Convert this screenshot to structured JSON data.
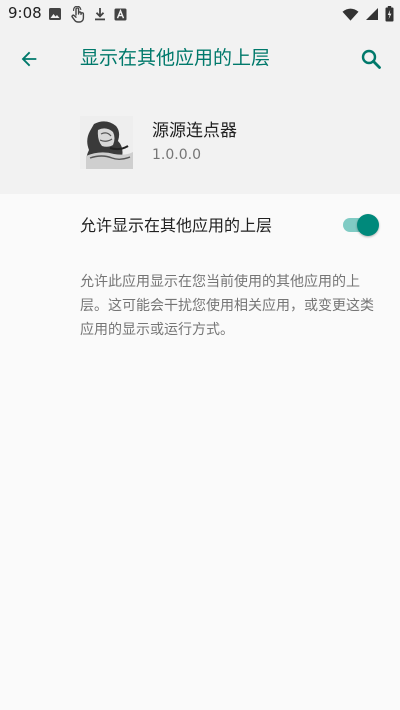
{
  "status_bar": {
    "time": "9:08",
    "left_icons": [
      "image-icon",
      "touch-icon",
      "download-icon",
      "a-box-icon"
    ],
    "right_icons": [
      "wifi-icon",
      "signal-icon",
      "battery-icon"
    ]
  },
  "app_bar": {
    "title": "显示在其他应用的上层",
    "back_icon": "arrow-back-icon",
    "search_icon": "search-icon"
  },
  "app_info": {
    "name": "源源连点器",
    "version": "1.0.0.0"
  },
  "setting": {
    "label": "允许显示在其他应用的上层",
    "enabled": true
  },
  "description": "允许此应用显示在您当前使用的其他应用的上层。这可能会干扰您使用相关应用，或变更这类应用的显示或运行方式。",
  "colors": {
    "accent": "#00796b",
    "switch_thumb": "#00897b",
    "switch_track": "#80cbc4",
    "header_background": "#f2f2f2",
    "page_background": "#fafafa"
  }
}
